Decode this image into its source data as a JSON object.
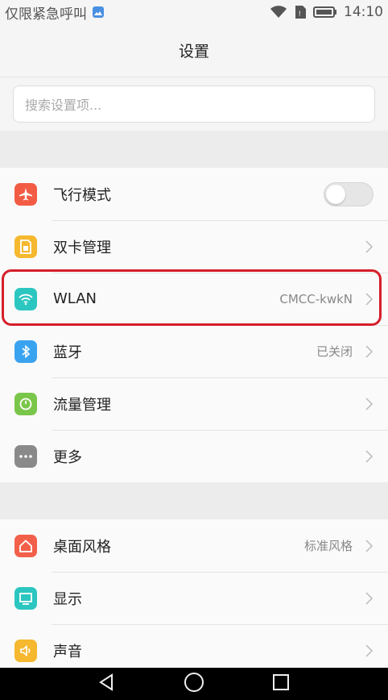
{
  "status_bar": {
    "carrier": "仅限紧急呼叫",
    "time": "14:10",
    "icons": [
      "image-notification-icon",
      "wifi-icon",
      "sim-icon",
      "battery-icon"
    ]
  },
  "title": "设置",
  "search": {
    "placeholder": "搜索设置项..."
  },
  "groups": [
    {
      "items": [
        {
          "label": "飞行模式",
          "icon": "airplane-icon",
          "icon_color": "#f25c45",
          "toggle": false
        },
        {
          "label": "双卡管理",
          "icon": "sim-card-icon",
          "icon_color": "#f5b82e"
        },
        {
          "label": "WLAN",
          "icon": "wifi-icon",
          "icon_color": "#2cc6c0",
          "value": "CMCC-kwkN",
          "highlighted": true
        },
        {
          "label": "蓝牙",
          "icon": "bluetooth-icon",
          "icon_color": "#3aa3f0",
          "value": "已关闭"
        },
        {
          "label": "流量管理",
          "icon": "data-usage-icon",
          "icon_color": "#7ac64a"
        },
        {
          "label": "更多",
          "icon": "more-icon",
          "icon_color": "#8a8a8a"
        }
      ]
    },
    {
      "items": [
        {
          "label": "桌面风格",
          "icon": "home-icon",
          "icon_color": "#f2604a",
          "value": "标准风格"
        },
        {
          "label": "显示",
          "icon": "display-icon",
          "icon_color": "#2cc6c0"
        },
        {
          "label": "声音",
          "icon": "sound-icon",
          "icon_color": "#f5b82e"
        }
      ]
    }
  ],
  "highlight_color": "#d61e2a",
  "nav_bar": [
    "back-icon",
    "home-nav-icon",
    "recents-icon"
  ]
}
